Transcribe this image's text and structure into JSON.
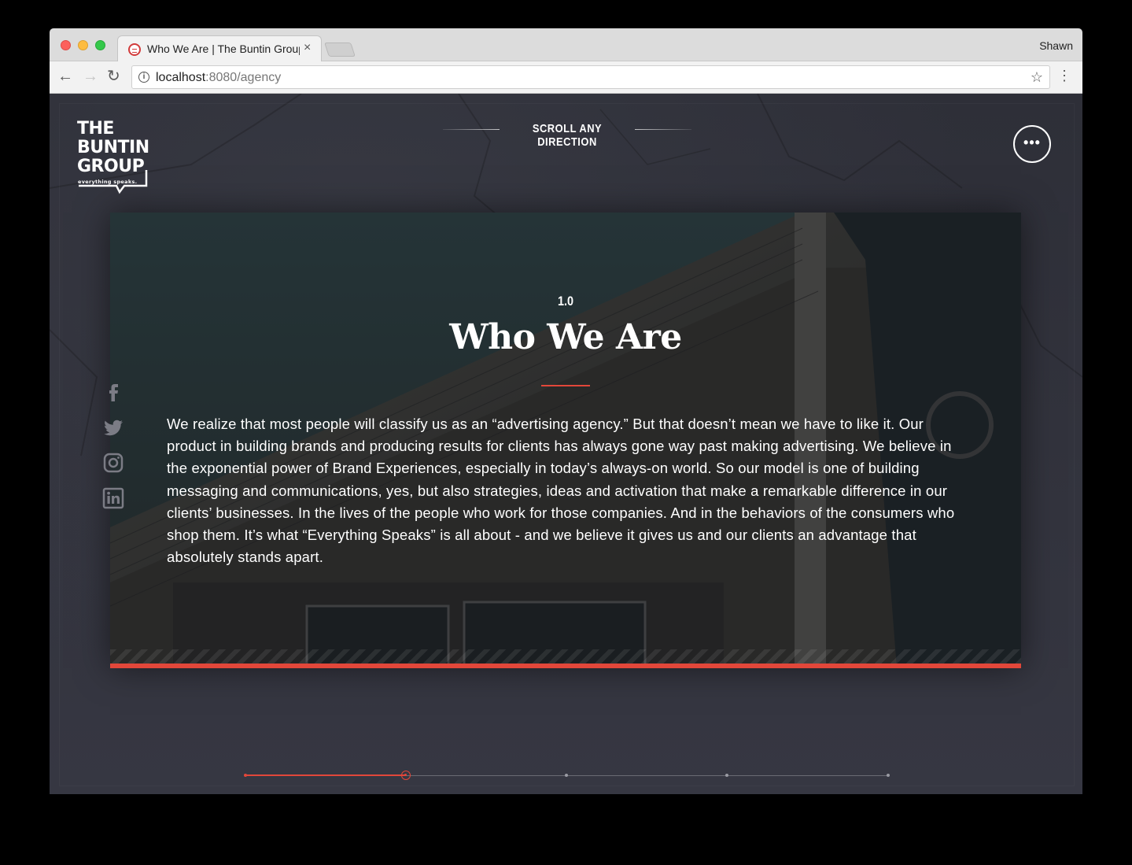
{
  "browser": {
    "tab_title": "Who We Are | The Buntin Group",
    "tab_close": "×",
    "profile_name": "Shawn",
    "url_host": "localhost",
    "url_rest": ":8080/agency",
    "info_icon": "i",
    "back_icon": "←",
    "forward_icon": "→",
    "reload_icon": "↻",
    "star_icon": "☆",
    "menu_icon": "⋮"
  },
  "header": {
    "logo_lines": [
      "THE",
      "BUNTIN",
      "GROUP"
    ],
    "logo_tagline": "everything speaks.",
    "scroll_hint": "SCROLL ANY DIRECTION",
    "menu_dots": "•••"
  },
  "hero": {
    "section_number": "1.0",
    "title": "Who We Are",
    "body": "We realize that most people will classify us as an “advertising agency.” But that doesn’t mean we have to like it. Our product in building brands and producing results for clients has always gone way past making advertising. We believe in the exponential power of Brand Experiences, especially in today’s always-on world. So our model is one of building messaging and communications, yes, but also strategies, ideas and activation that make a remarkable difference in our clients’ businesses. In the lives of the people who work for those companies. And in the behaviors of the consumers who shop them. It’s what “Everything Speaks” is all about - and we believe it gives us and our clients an advantage that absolutely stands apart."
  },
  "social": [
    "facebook-icon",
    "twitter-icon",
    "instagram-icon",
    "linkedin-icon"
  ],
  "progress": {
    "total_steps": 5,
    "active_step": 2
  },
  "colors": {
    "accent": "#e2473a",
    "background": "#2e2f38"
  }
}
